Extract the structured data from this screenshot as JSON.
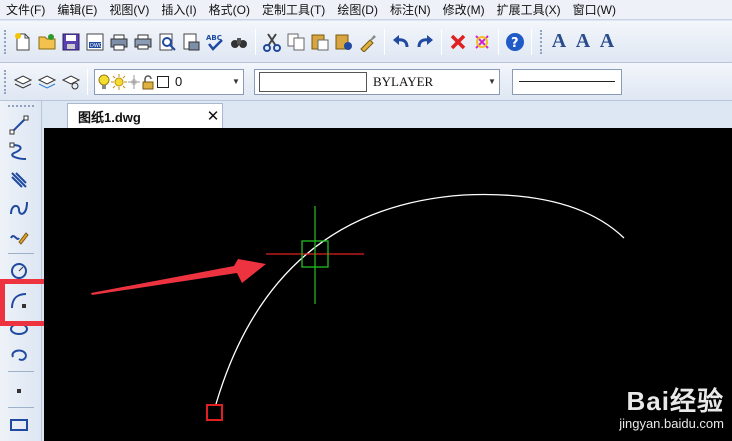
{
  "menu": {
    "items": [
      "文件(F)",
      "编辑(E)",
      "视图(V)",
      "插入(I)",
      "格式(O)",
      "定制工具(T)",
      "绘图(D)",
      "标注(N)",
      "修改(M)",
      "扩展工具(X)",
      "窗口(W)"
    ]
  },
  "toolbar1": {
    "icons": [
      "new-file-icon",
      "open-file-icon",
      "save-icon",
      "save-as-icon",
      "plot-icon",
      "print-icon",
      "print-preview-icon",
      "publish-icon",
      "spell-check-icon",
      "find-icon",
      "cut-icon",
      "copy-icon",
      "paste-icon",
      "paste-special-icon",
      "match-properties-icon",
      "undo-icon",
      "redo-icon",
      "delete-icon",
      "purge-icon",
      "help-icon"
    ],
    "text_style_glyphs": [
      "A",
      "A",
      "A"
    ]
  },
  "toolbar2": {
    "layer_value": "0",
    "color_value": "BYLAYER"
  },
  "tabs": {
    "active": "图纸1.dwg"
  },
  "left_toolbar": {
    "tools": [
      "line-tool-icon",
      "polyline-tool-icon",
      "multiline-tool-icon",
      "spline-tool-icon",
      "freehand-tool-icon",
      "circle-tool-icon",
      "arc-tool-icon",
      "ellipse-tool-icon",
      "revision-cloud-tool-icon",
      "point-tool-icon",
      "rectangle-tool-icon"
    ],
    "highlighted_tool": "arc-tool-icon"
  },
  "watermark": {
    "brand": "Bai经验",
    "url": "jingyan.baidu.com"
  },
  "colors": {
    "canvas": "#000000",
    "highlight": "#ee3340",
    "crosshair_h": "#e02020",
    "crosshair_v": "#22c022",
    "arc": "#ffffff",
    "arrow": "#ee3340"
  }
}
